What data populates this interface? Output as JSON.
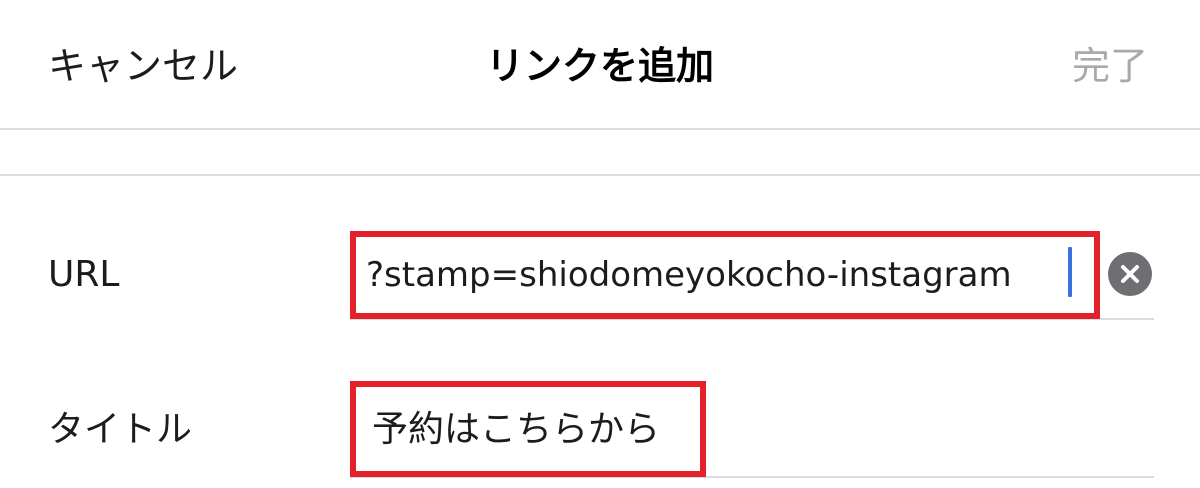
{
  "nav": {
    "cancel_label": "キャンセル",
    "title": "リンクを追加",
    "done_label": "完了"
  },
  "form": {
    "url_label": "URL",
    "url_value": "?stamp=shiodomeyokocho-instagram",
    "title_label": "タイトル",
    "title_value": "予約はこちらから",
    "clear_icon": "clear-circle-icon"
  },
  "colors": {
    "highlight": "#e3212b",
    "caret": "#3a6fe0",
    "done_disabled": "#a8a8ad",
    "clear_button": "#6e6e73"
  }
}
